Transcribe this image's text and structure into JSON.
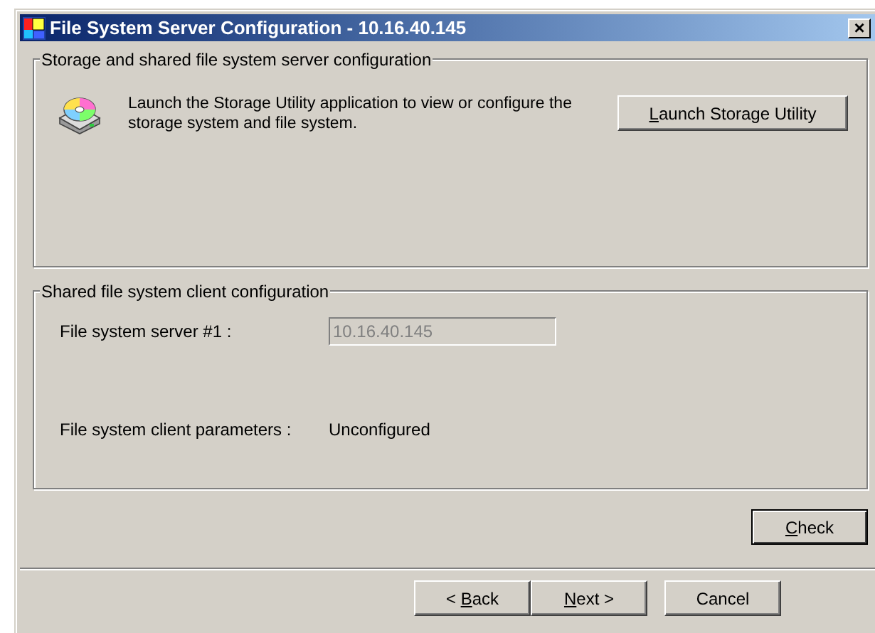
{
  "window": {
    "title": "File System Server Configuration - 10.16.40.145",
    "close_button": "×"
  },
  "storage_group": {
    "title": "Storage and shared file system server configuration",
    "description": "Launch the Storage Utility application to view or configure the storage system and file system.",
    "button": {
      "key": "L",
      "rest": "aunch Storage Utility"
    }
  },
  "client_group": {
    "title": "Shared file system client configuration",
    "server_label": "File system server #1 :",
    "server_value": "10.16.40.145",
    "server_disabled": true,
    "params_label": "File system client parameters :",
    "params_value": "Unconfigured"
  },
  "check_button": {
    "key": "C",
    "rest": "heck",
    "default": true
  },
  "buttons": [
    {
      "before": "< ",
      "key": "B",
      "rest": "ack"
    },
    {
      "key": "N",
      "rest": "ext >"
    },
    {
      "rest": "Cancel"
    }
  ]
}
